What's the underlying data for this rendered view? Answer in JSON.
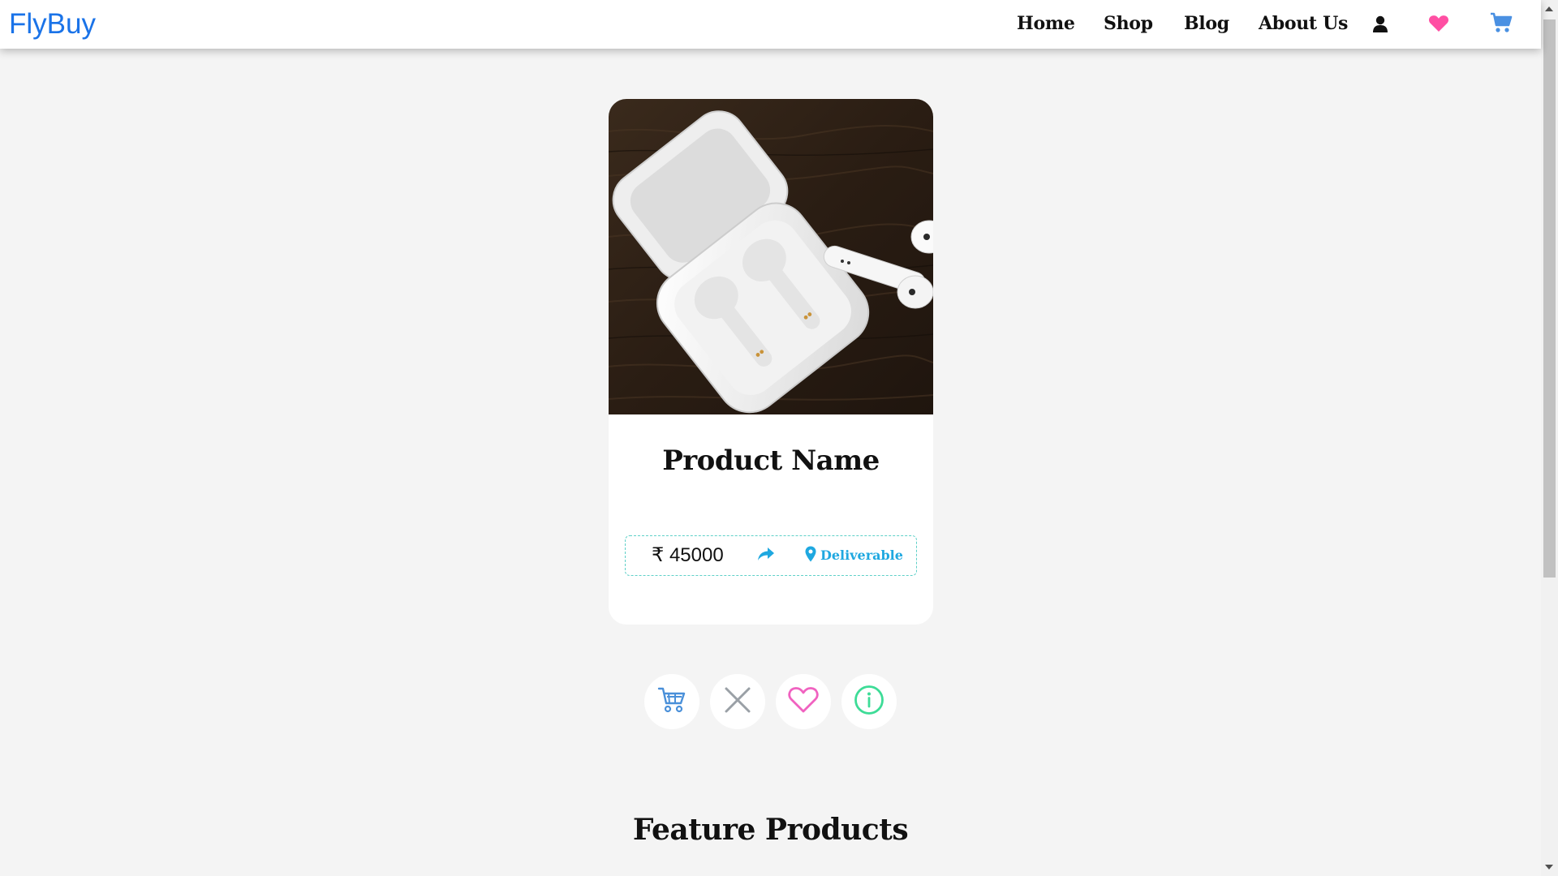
{
  "brand": "FlyBuy",
  "nav": {
    "links": [
      "Home",
      "Shop",
      "Blog",
      "About Us"
    ],
    "icons": [
      "user-icon",
      "heart-icon",
      "cart-icon"
    ]
  },
  "product": {
    "name": "Product Name",
    "price": "₹ 45000",
    "share_icon": "share-arrow-icon",
    "delivery_icon": "map-pin-icon",
    "delivery_status": "Deliverable"
  },
  "actions": [
    {
      "icon": "cart-icon",
      "color": "#4a90d9"
    },
    {
      "icon": "close-icon",
      "color": "#9aa0a6"
    },
    {
      "icon": "heart-outline-icon",
      "color": "#f062c0"
    },
    {
      "icon": "info-icon",
      "color": "#3ddc97"
    }
  ],
  "sections": {
    "feature_heading": "Feature Products"
  },
  "colors": {
    "brand": "#1a73e8",
    "nav_heart": "#ff4fa3",
    "nav_cart": "#4a90e2",
    "accent_blue": "#1fa8e0",
    "info_border": "#5fd0c8",
    "page_bg": "#f4f4f4"
  }
}
